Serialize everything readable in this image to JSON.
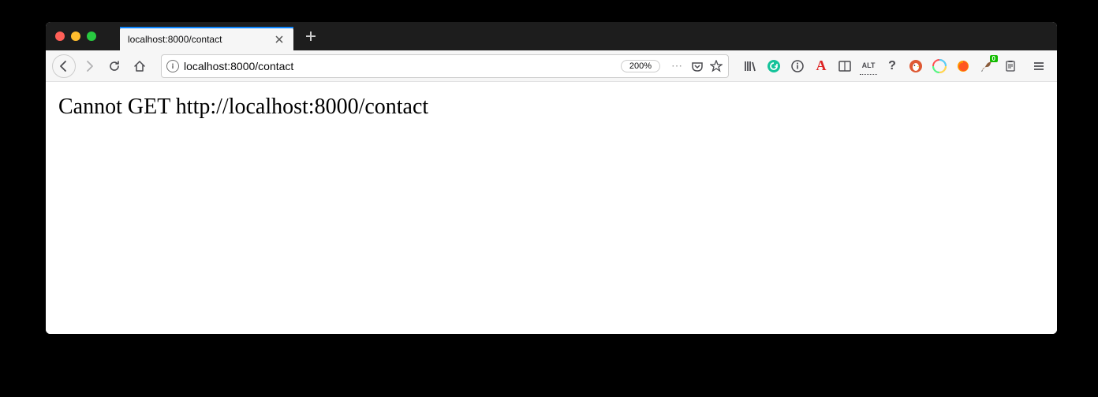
{
  "window": {
    "tab_title": "localhost:8000/contact"
  },
  "toolbar": {
    "url": "localhost:8000/contact",
    "zoom_level": "200%"
  },
  "page": {
    "error_message": "Cannot GET http://localhost:8000/contact"
  },
  "icons": {
    "close": "close-icon",
    "minimize": "minimize-icon",
    "maximize": "maximize-icon",
    "back": "back-icon",
    "forward": "forward-icon",
    "reload": "reload-icon",
    "home": "home-icon",
    "info": "info-icon",
    "ellipsis": "ellipsis-icon",
    "pocket": "pocket-icon",
    "star": "star-icon",
    "library": "library-icon",
    "grammarly": "grammarly-icon",
    "ext_info": "ext-info-icon",
    "font": "font-letter-icon",
    "reader": "reader-icon",
    "alt": "alt-icon",
    "help": "help-icon",
    "duckduckgo": "duckduckgo-icon",
    "colorful": "colorful-icon",
    "firefox": "firefox-icon",
    "stylus": "stylus-icon",
    "clipboard": "clipboard-icon",
    "hamburger": "hamburger-icon",
    "newtab": "new-tab-icon",
    "tabclose": "tab-close-icon"
  }
}
